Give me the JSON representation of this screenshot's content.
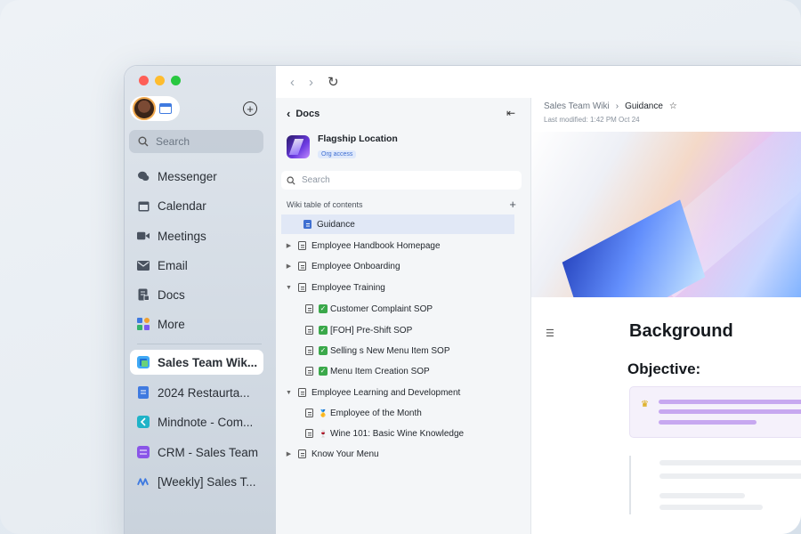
{
  "nav": {
    "search_placeholder": "Search",
    "items": [
      {
        "label": "Messenger",
        "icon": "chat-bubble-icon"
      },
      {
        "label": "Calendar",
        "icon": "calendar-icon"
      },
      {
        "label": "Meetings",
        "icon": "video-camera-icon"
      },
      {
        "label": "Email",
        "icon": "envelope-icon"
      },
      {
        "label": "Docs",
        "icon": "docs-icon"
      },
      {
        "label": "More",
        "icon": "grid-apps-icon"
      }
    ],
    "pinned": [
      {
        "label": "Sales Team Wik...",
        "icon": "wiki-icon",
        "active": true
      },
      {
        "label": "2024 Restaurta...",
        "icon": "doc-blue-icon"
      },
      {
        "label": "Mindnote - Com...",
        "icon": "mindnote-icon"
      },
      {
        "label": "CRM - Sales Team",
        "icon": "base-icon"
      },
      {
        "label": "[Weekly] Sales T...",
        "icon": "meeting-notes-icon"
      }
    ]
  },
  "docs": {
    "back_label": "Docs",
    "space_title": "Flagship Location",
    "space_badge": "Org access",
    "search_placeholder": "Search",
    "toc_label": "Wiki table of contents",
    "toc": [
      {
        "label": "Guidance",
        "level": 0,
        "caret": "",
        "selected": true
      },
      {
        "label": "Employee Handbook Homepage",
        "level": 0,
        "caret": "▶"
      },
      {
        "label": "Employee Onboarding",
        "level": 0,
        "caret": "▶"
      },
      {
        "label": "Employee Training",
        "level": 0,
        "caret": "▼"
      },
      {
        "label": "Customer Complaint SOP",
        "level": 1,
        "mark": "check"
      },
      {
        "label": "[FOH] Pre-Shift SOP",
        "level": 1,
        "mark": "check"
      },
      {
        "label": "Selling s New Menu Item SOP",
        "level": 1,
        "mark": "check"
      },
      {
        "label": "Menu Item Creation SOP",
        "level": 1,
        "mark": "check"
      },
      {
        "label": "Employee Learning and Development",
        "level": 0,
        "caret": "▼"
      },
      {
        "label": "Employee of the Month",
        "level": 1,
        "mark": "🥇"
      },
      {
        "label": "Wine 101: Basic Wine Knowledge",
        "level": 1,
        "mark": "🍷"
      },
      {
        "label": "Know Your Menu",
        "level": 0,
        "caret": "▶"
      }
    ]
  },
  "content": {
    "crumb_parent": "Sales Team Wiki",
    "crumb_current": "Guidance",
    "modified": "Last modified: 1:42 PM Oct 24",
    "heading": "Background",
    "subheading": "Objective:"
  },
  "colors": {
    "traffic_red": "#fe5f57",
    "traffic_yellow": "#febc2e",
    "traffic_green": "#28c840",
    "accent": "#3f6fd1",
    "callout_bar": "#c7a8f0"
  }
}
